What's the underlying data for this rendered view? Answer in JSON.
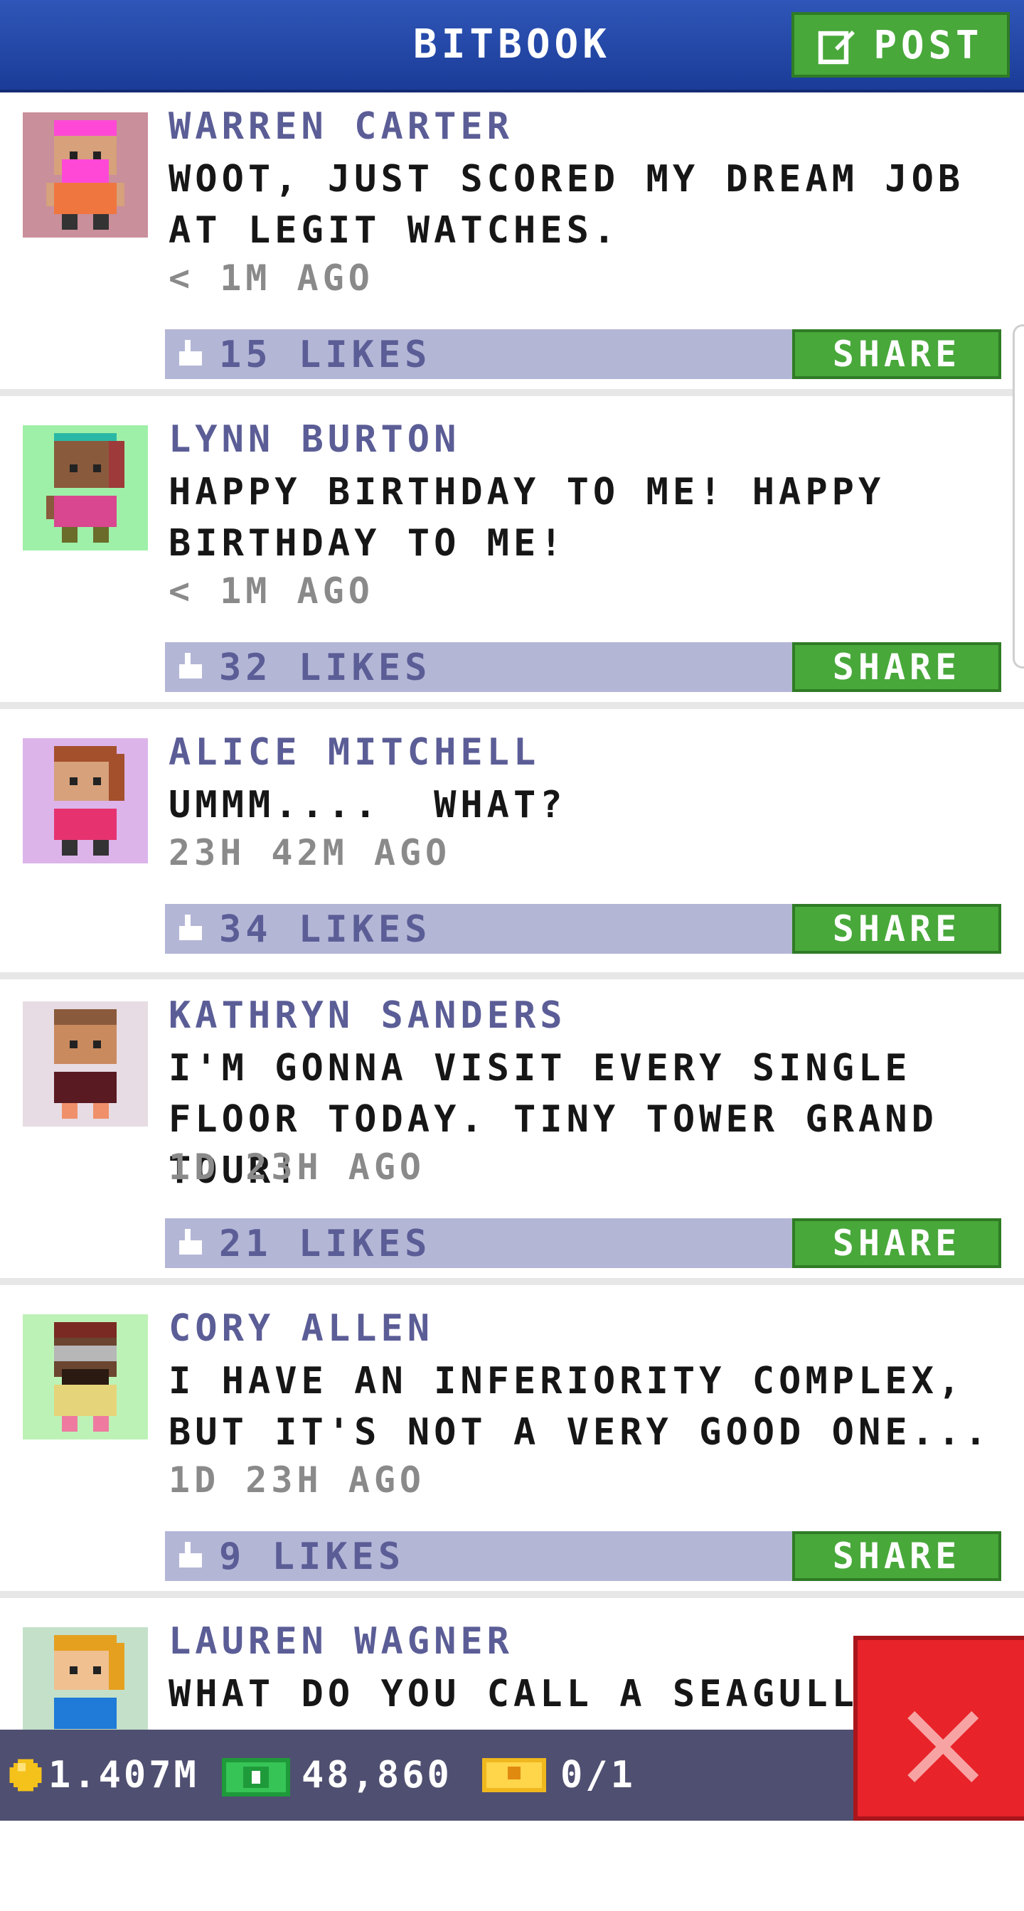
{
  "header": {
    "title": "BITBOOK",
    "post_label": "POST"
  },
  "posts": [
    {
      "name": "WARREN CARTER",
      "message": "WOOT, JUST SCORED MY DREAM JOB AT LEGIT WATCHES.",
      "time": "< 1M AGO",
      "likes": "15 LIKES",
      "share_label": "SHARE",
      "avatar_bg": "#c98f9a"
    },
    {
      "name": "LYNN BURTON",
      "message": "HAPPY BIRTHDAY TO ME! HAPPY BIRTHDAY TO ME!",
      "time": "< 1M AGO",
      "likes": "32 LIKES",
      "share_label": "SHARE",
      "avatar_bg": "#9ef0a8"
    },
    {
      "name": "ALICE MITCHELL",
      "message": "UMMM....  WHAT?",
      "time": "23H 42M AGO",
      "likes": "34 LIKES",
      "share_label": "SHARE",
      "avatar_bg": "#dcb4ea"
    },
    {
      "name": "KATHRYN SANDERS",
      "message": "I'M GONNA VISIT EVERY SINGLE FLOOR TODAY. TINY TOWER GRAND TOUR!",
      "time": "1D 23H AGO",
      "likes": "21 LIKES",
      "share_label": "SHARE",
      "avatar_bg": "#e7dce3"
    },
    {
      "name": "CORY ALLEN",
      "message": "I HAVE AN INFERIORITY COMPLEX, BUT IT'S NOT A VERY GOOD ONE...",
      "time": "1D 23H AGO",
      "likes": "9 LIKES",
      "share_label": "SHARE",
      "avatar_bg": "#bdf2b6"
    },
    {
      "name": "LAUREN WAGNER",
      "message": "WHAT DO YOU CALL A SEAGULL",
      "time": "",
      "likes": "",
      "share_label": "",
      "avatar_bg": "#c4e0c9"
    }
  ],
  "footer": {
    "coins": "1.407M",
    "bux": "48,860",
    "tickets": "0/1"
  },
  "colors": {
    "header": "#2a4fae",
    "accent_green": "#48a83a",
    "like_bar": "#b4b6d6",
    "name_text": "#5b5d96",
    "close_red": "#e8232a"
  }
}
